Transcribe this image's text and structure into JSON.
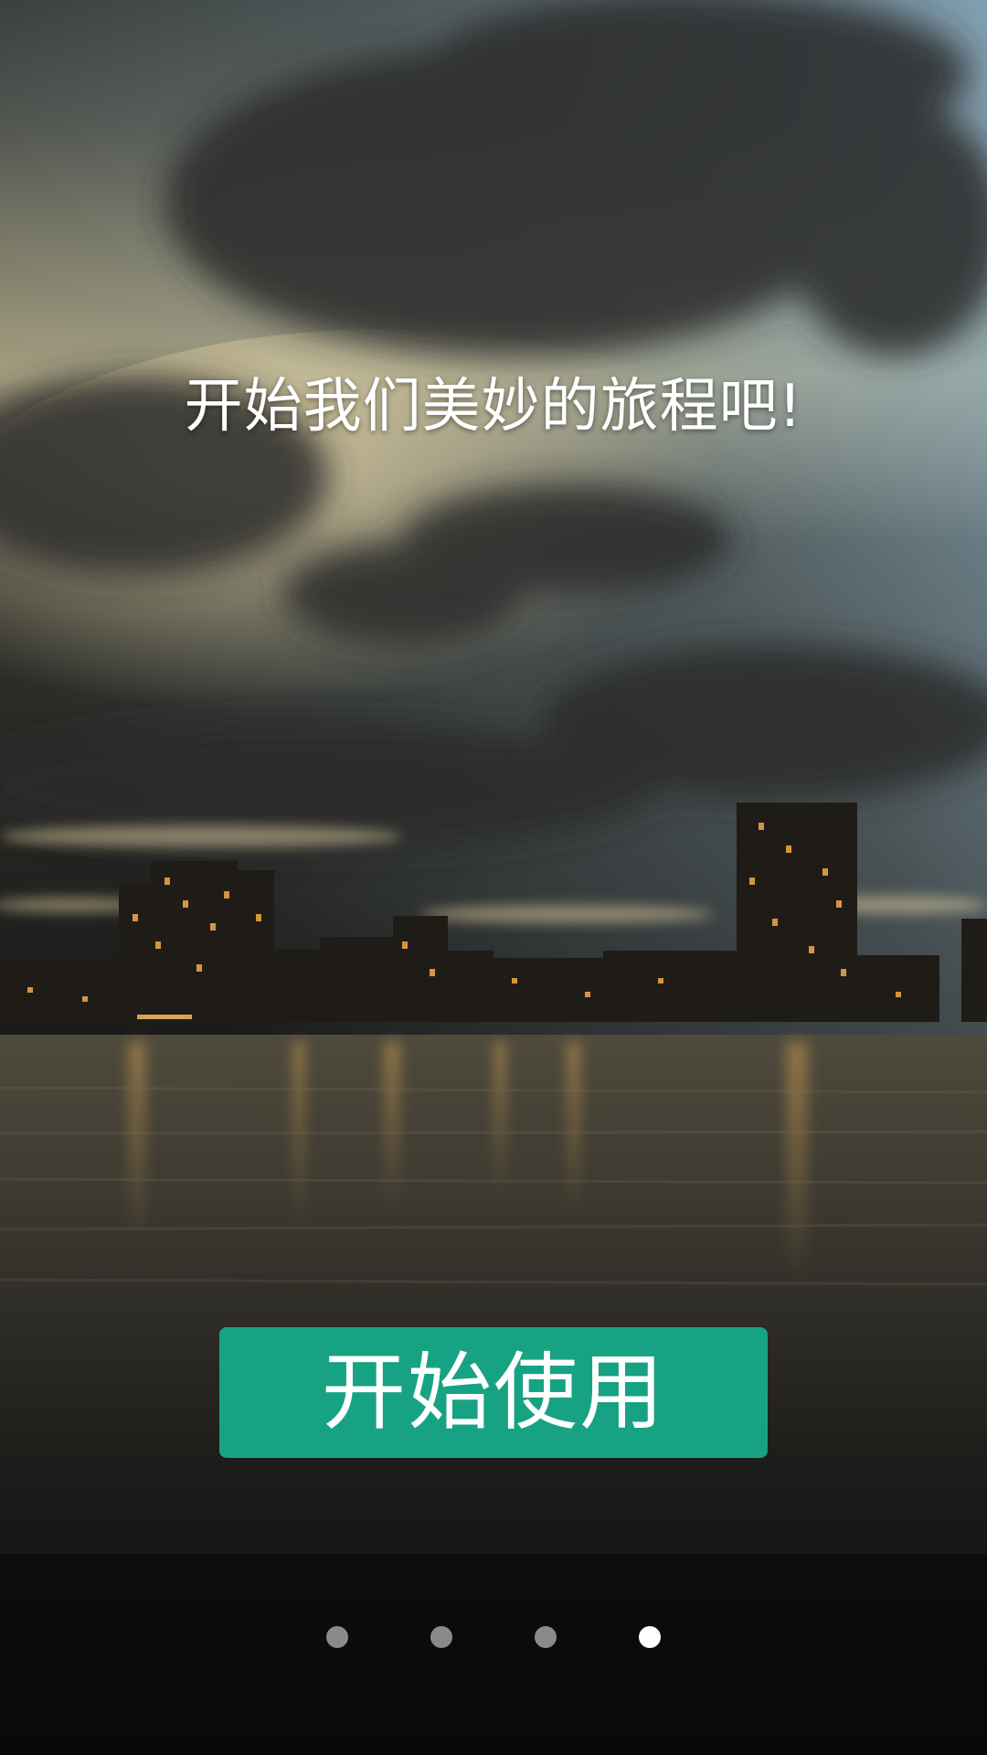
{
  "headline": "开始我们美妙的旅程吧!",
  "start_button": {
    "label": "开始使用",
    "color": "#17a383"
  },
  "pager": {
    "count": 4,
    "active_index": 3,
    "active_color": "#ffffff",
    "inactive_color": "#8a8a8a"
  }
}
